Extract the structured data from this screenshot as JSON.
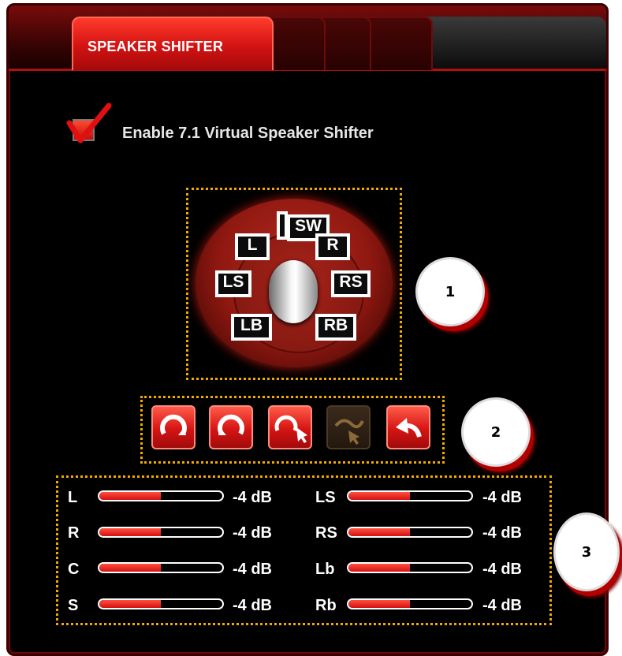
{
  "tabs": {
    "active_label": "SPEAKER SHIFTER"
  },
  "enable": {
    "label": "Enable 7.1 Virtual Speaker Shifter",
    "checked": true
  },
  "speakers": [
    "L",
    "SW",
    "R",
    "LS",
    "RS",
    "LB",
    "RB"
  ],
  "callouts": [
    "1",
    "2",
    "3"
  ],
  "toolbar": {
    "buttons": [
      {
        "icon": "rotate-clockwise-icon",
        "enabled": true
      },
      {
        "icon": "rotate-counterclockwise-icon",
        "enabled": true
      },
      {
        "icon": "rotate-manual-drag-icon",
        "enabled": true
      },
      {
        "icon": "drag-move-icon",
        "enabled": false
      },
      {
        "icon": "reset-undo-icon",
        "enabled": true
      }
    ]
  },
  "levels": {
    "left": [
      {
        "channel": "L",
        "value": "-4 dB",
        "fill": 0.5
      },
      {
        "channel": "R",
        "value": "-4 dB",
        "fill": 0.5
      },
      {
        "channel": "C",
        "value": "-4 dB",
        "fill": 0.5
      },
      {
        "channel": "S",
        "value": "-4 dB",
        "fill": 0.5
      }
    ],
    "right": [
      {
        "channel": "LS",
        "value": "-4 dB",
        "fill": 0.5
      },
      {
        "channel": "RS",
        "value": "-4 dB",
        "fill": 0.5
      },
      {
        "channel": "Lb",
        "value": "-4 dB",
        "fill": 0.5
      },
      {
        "channel": "Rb",
        "value": "-4 dB",
        "fill": 0.5
      }
    ]
  },
  "colors": {
    "accent": "#d21212",
    "highlight_border": "#f2a900",
    "background": "#000000"
  }
}
